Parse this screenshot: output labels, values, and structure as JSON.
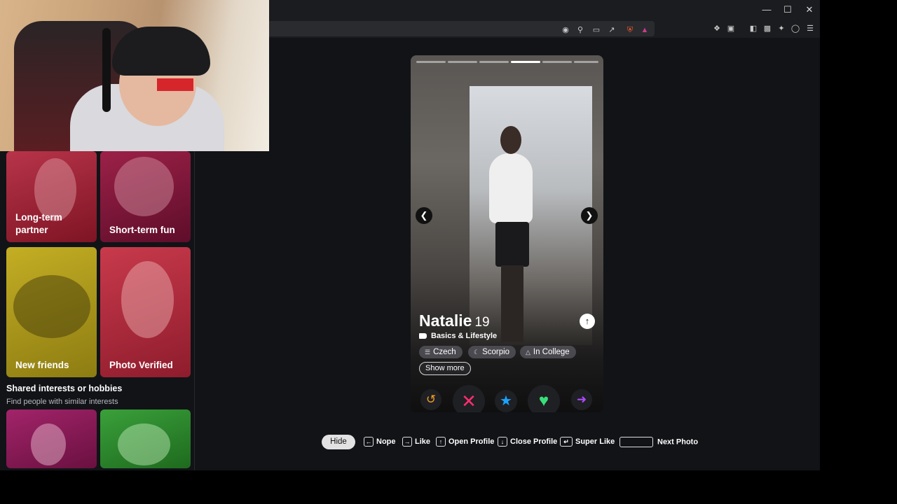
{
  "window": {
    "minimize_icon": "minimize-icon",
    "maximize_icon": "maximize-icon",
    "close_icon": "close-icon"
  },
  "toolbar": {
    "icons": [
      "location-icon",
      "zoom-icon",
      "cast-icon",
      "share-icon",
      "brave-shield-icon",
      "brave-rewards-icon",
      "extensions-icon",
      "screenshot-icon",
      "sidebar-icon",
      "wallet-icon",
      "leo-ai-icon",
      "vpn-icon",
      "menu-icon"
    ]
  },
  "sidebar": {
    "tiles": [
      {
        "label": "Long-term partner",
        "color": "#8c1f2a"
      },
      {
        "label": "Short-term fun",
        "color": "#7a1236"
      },
      {
        "label": "New friends",
        "color": "#a8951a"
      },
      {
        "label": "Photo Verified",
        "color": "#b52a3e"
      }
    ],
    "section_title": "Shared interests or hobbies",
    "section_subtitle": "Find people with similar interests",
    "bottom_tiles": [
      {
        "color": "#8a1b54"
      },
      {
        "color": "#2e8a2e"
      }
    ]
  },
  "profile": {
    "name": "Natalie",
    "age": "19",
    "section": "Basics & Lifestyle",
    "chips": [
      "Czech",
      "Scorpio",
      "In College"
    ],
    "show_more": "Show more",
    "photo_count": 6,
    "active_photo": 4
  },
  "actions": [
    {
      "name": "rewind-icon",
      "color": "#f0a020"
    },
    {
      "name": "nope-icon",
      "color": "#ff2d6e"
    },
    {
      "name": "super-like-icon",
      "color": "#1aa3ff"
    },
    {
      "name": "like-icon",
      "color": "#39e07a"
    },
    {
      "name": "boost-icon",
      "color": "#b04bff"
    }
  ],
  "shortcuts": {
    "hide": "Hide",
    "nope": "Nope",
    "like": "Like",
    "open_profile": "Open Profile",
    "close_profile": "Close Profile",
    "super_like": "Super Like",
    "next_photo": "Next Photo"
  }
}
